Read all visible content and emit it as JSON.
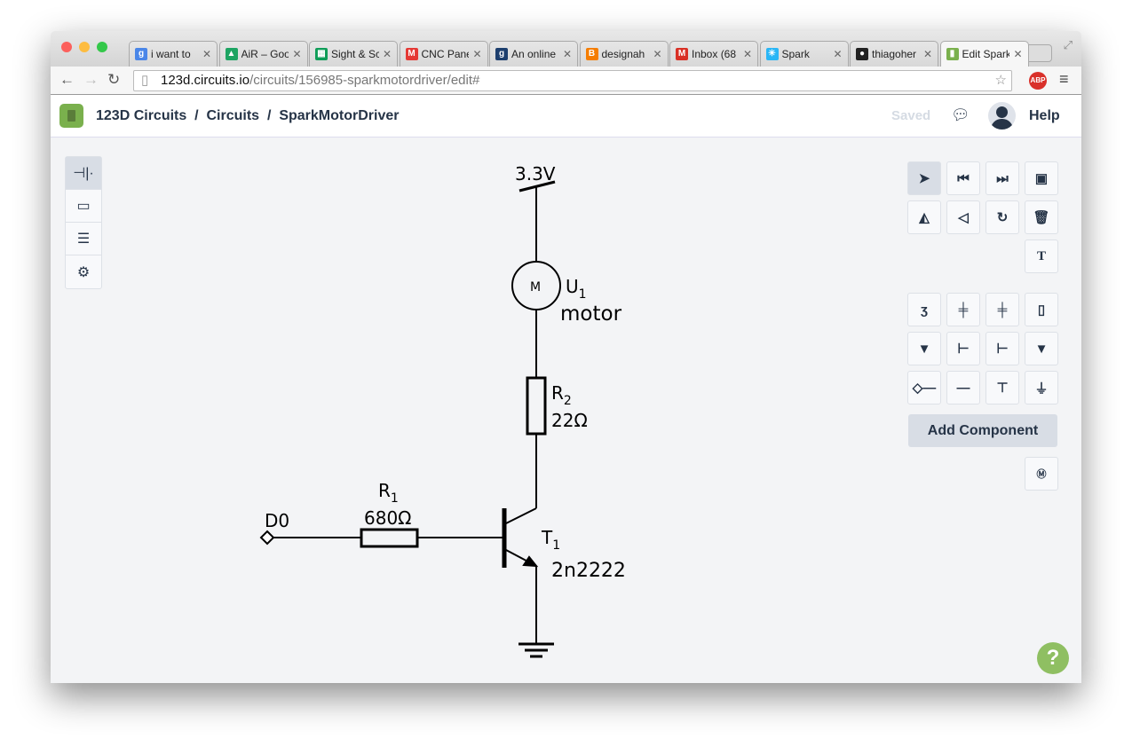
{
  "browser": {
    "tabs": [
      {
        "title": "i want to",
        "fav": "g",
        "color": "#4a86e8"
      },
      {
        "title": "AiR – Goo",
        "fav": "▲",
        "color": "#1da462"
      },
      {
        "title": "Sight & Sc",
        "fav": "▦",
        "color": "#0f9d58"
      },
      {
        "title": "CNC Pane",
        "fav": "M",
        "color": "#e53935"
      },
      {
        "title": "An online",
        "fav": "g",
        "color": "#1d3f6e"
      },
      {
        "title": "designah",
        "fav": "B",
        "color": "#f57d00"
      },
      {
        "title": "Inbox (68",
        "fav": "M",
        "color": "#d93025"
      },
      {
        "title": "Spark",
        "fav": "✳",
        "color": "#29b6f6"
      },
      {
        "title": "thiagoher",
        "fav": "●",
        "color": "#222"
      },
      {
        "title": "Edit Spark",
        "fav": "▮",
        "color": "#7ab04d"
      }
    ],
    "url_host": "123d.circuits.io",
    "url_path": "/circuits/156985-sparkmotordriver/edit#",
    "abp": "ABP"
  },
  "app": {
    "crumbs": [
      "123D Circuits",
      "/",
      "Circuits",
      "/",
      "SparkMotorDriver"
    ],
    "saved": "Saved",
    "help": "Help"
  },
  "toolbar": {
    "add_component": "Add Component",
    "text_tool": "T"
  },
  "schematic": {
    "supply": "3.3V",
    "motor": {
      "ref": "U",
      "sub": "1",
      "value": "motor",
      "symbol": "M"
    },
    "r2": {
      "ref": "R",
      "sub": "2",
      "value": "22Ω"
    },
    "r1": {
      "ref": "R",
      "sub": "1",
      "value": "680Ω"
    },
    "t1": {
      "ref": "T",
      "sub": "1",
      "value": "2n2222"
    },
    "input": "D0"
  },
  "help_bubble": "?"
}
